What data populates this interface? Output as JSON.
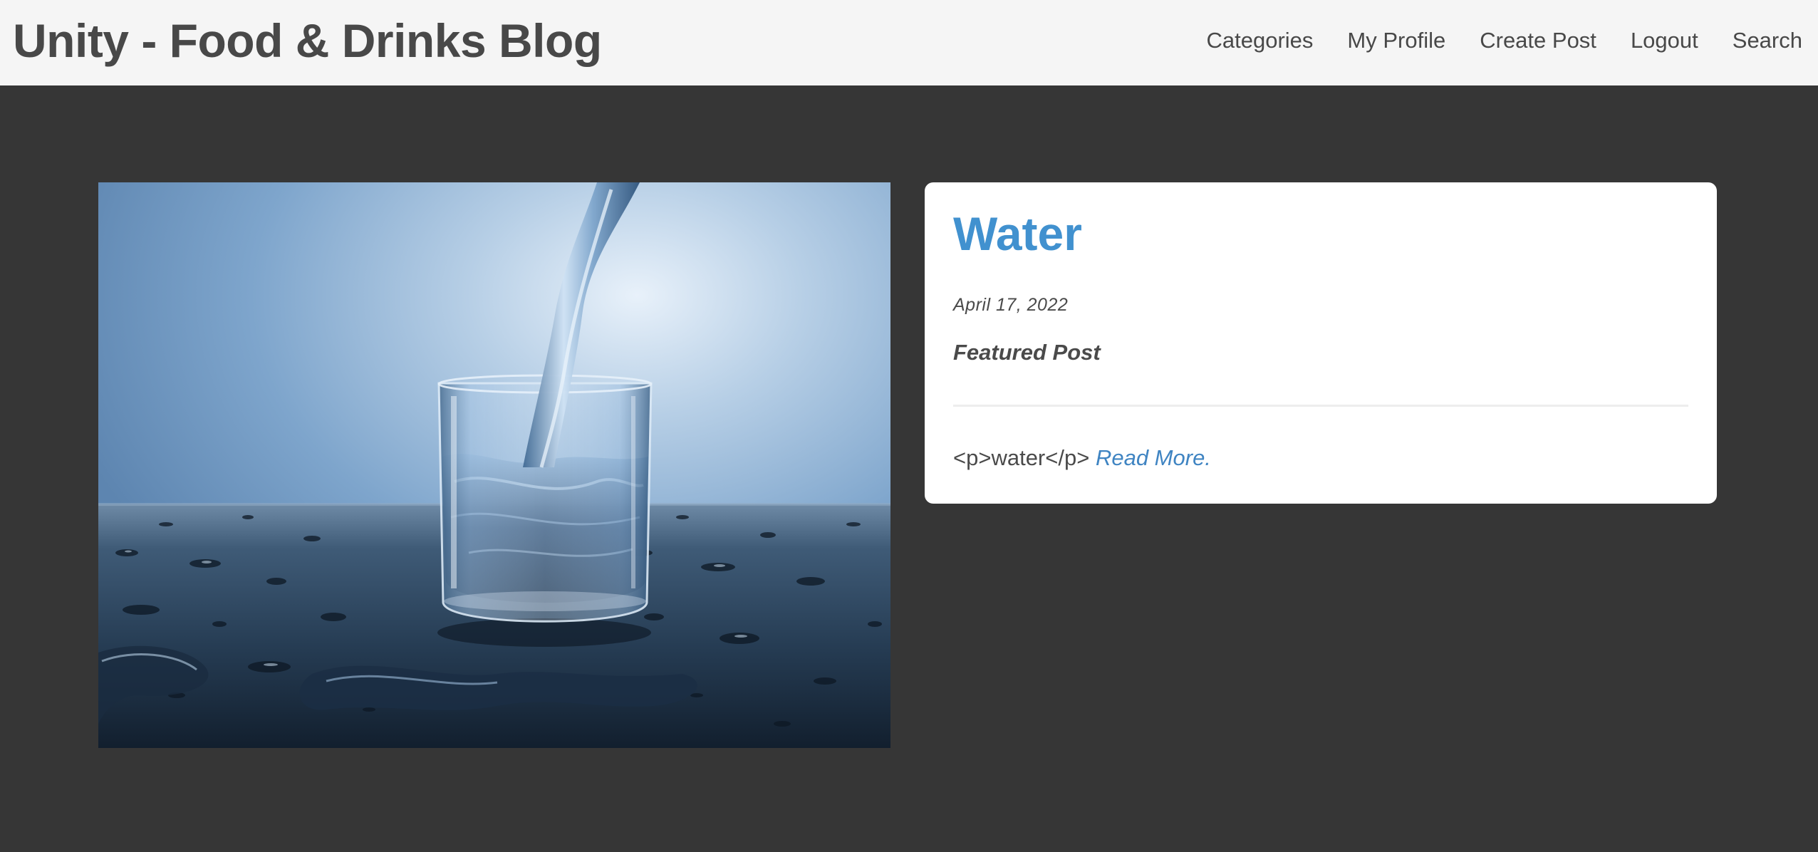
{
  "header": {
    "brand": "Unity - Food & Drinks Blog",
    "nav": {
      "categories": "Categories",
      "my_profile": "My Profile",
      "create_post": "Create Post",
      "logout": "Logout",
      "search": "Search"
    }
  },
  "post": {
    "title": "Water",
    "date": "April 17, 2022",
    "featured_label": "Featured Post",
    "excerpt": "<p>water</p>",
    "read_more": "Read More.",
    "image_subject": "glass-of-water-pouring-photo"
  },
  "colors": {
    "page_background": "#363636",
    "header_background": "#f5f5f5",
    "header_text": "#484848",
    "title_accent": "#4191cf",
    "link": "#3f84c2",
    "card_background": "#ffffff"
  }
}
